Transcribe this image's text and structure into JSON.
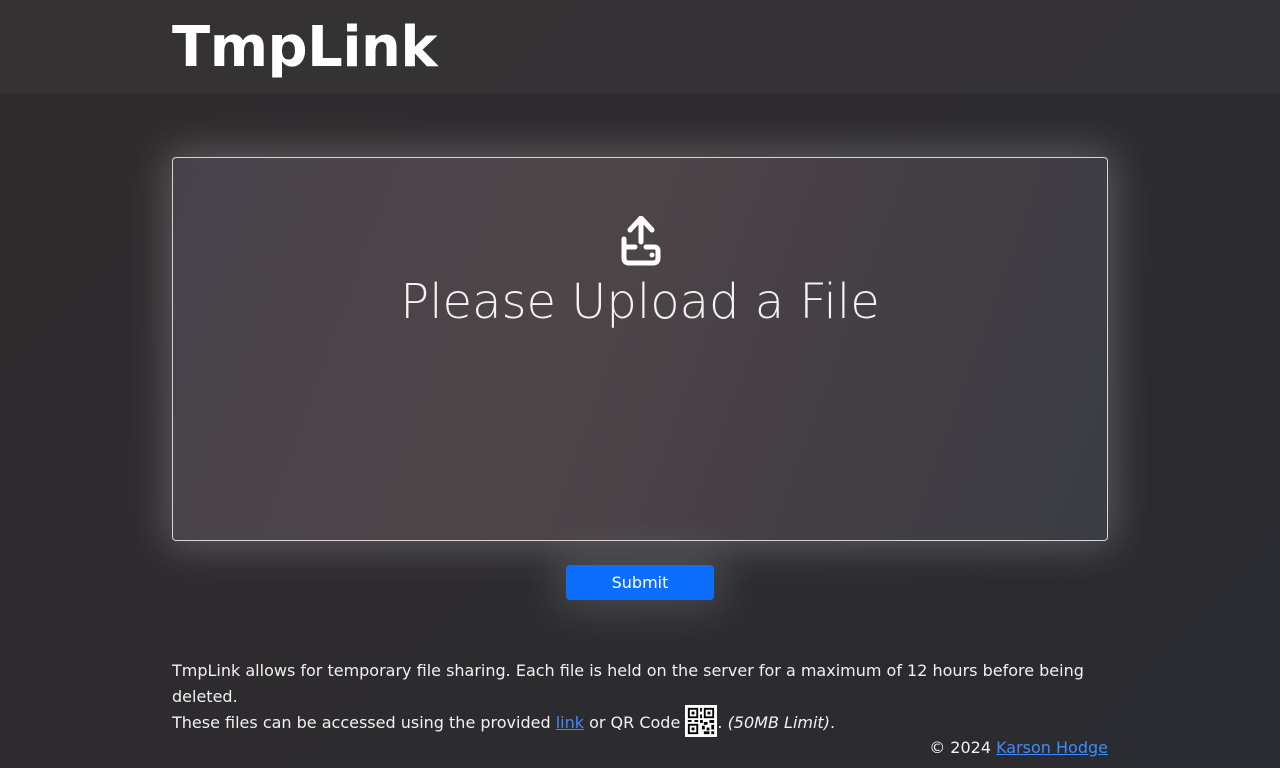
{
  "header": {
    "brand": "TmpLink"
  },
  "upload": {
    "icon": "upload-icon",
    "title": "Please Upload a File"
  },
  "submit": {
    "label": "Submit"
  },
  "description": {
    "line1": "TmpLink allows for temporary file sharing. Each file is held on the server for a maximum of 12 hours before being deleted.",
    "line2_prefix": "These files can be accessed using the provided ",
    "link_label": "link",
    "line2_middle": " or QR Code ",
    "qr_icon": "qr-code-icon",
    "line2_after_qr": ". ",
    "limit": "(50MB Limit)",
    "line2_end": "."
  },
  "footer": {
    "copyright": "© 2024 ",
    "author": "Karson Hodge"
  },
  "colors": {
    "accent": "#0d6efd",
    "link": "#3d8bfd",
    "background": "#2d2b2e"
  }
}
